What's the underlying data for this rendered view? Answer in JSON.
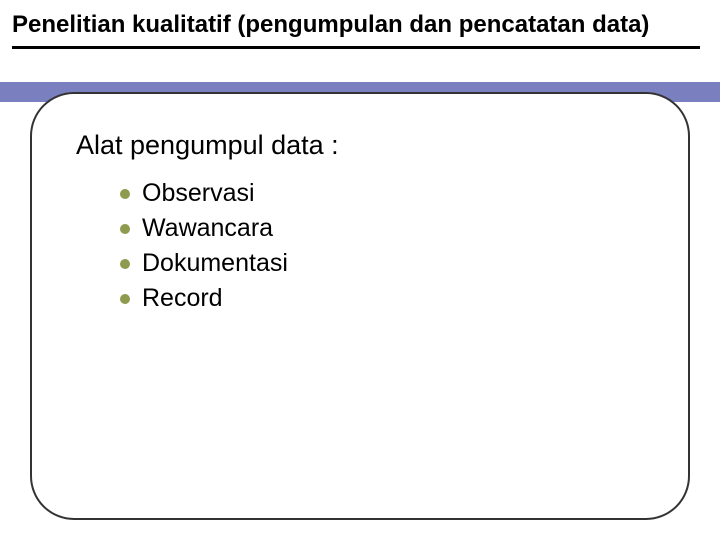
{
  "colors": {
    "accent_bar": "#7a7fc0",
    "bullet": "#8e9a4d",
    "border": "#333333"
  },
  "title": "Penelitian kualitatif (pengumpulan dan pencatatan data)",
  "section_heading": "Alat pengumpul data :",
  "bullets": [
    "Observasi",
    "Wawancara",
    "Dokumentasi",
    "Record"
  ]
}
